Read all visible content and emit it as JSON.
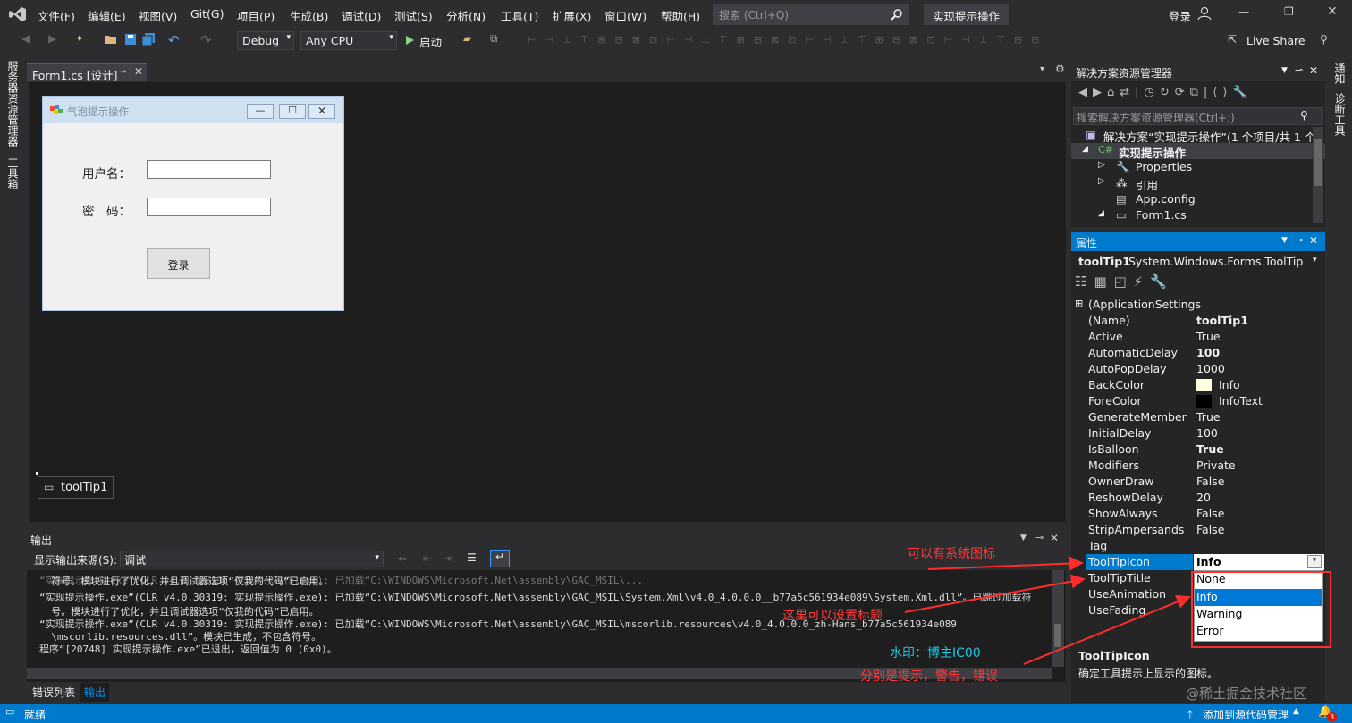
{
  "menu": {
    "items": [
      "文件(F)",
      "编辑(E)",
      "视图(V)",
      "Git(G)",
      "项目(P)",
      "生成(B)",
      "调试(D)",
      "测试(S)",
      "分析(N)",
      "工具(T)",
      "扩展(X)",
      "窗口(W)",
      "帮助(H)"
    ],
    "search_placeholder": "搜索 (Ctrl+Q)",
    "project": "实现提示操作",
    "login": "登录"
  },
  "toolbar": {
    "config": "Debug",
    "platform": "Any CPU",
    "start": "启动",
    "live_share": "Live Share"
  },
  "left_strip": {
    "server_explorer": "服务器资源管理器",
    "toolbox": "工具箱"
  },
  "right_strip": {
    "notifications": "通知",
    "diagnostics": "诊断工具"
  },
  "document": {
    "tab": "Form1.cs [设计]"
  },
  "form": {
    "title": "气泡提示操作",
    "username_label": "用户名：",
    "password_label": "密　码：",
    "login_button": "登录"
  },
  "tray": {
    "component": "toolTip1"
  },
  "output": {
    "title": "输出",
    "source_label": "显示输出来源(S):",
    "source_value": "调试",
    "lines": [
      "  符号。模块进行了优化，并且调试器选项“仅我的代码”已启用。",
      "“实现提示操作.exe”(CLR v4.0.30319: 实现提示操作.exe): 已加载“C:\\WINDOWS\\Microsoft.Net\\assembly\\GAC_MSIL\\System.Xml\\v4.0_4.0.0.0__b77a5c561934e089\\System.Xml.dll”。已跳过加载符",
      "  号。模块进行了优化，并且调试器选项“仅我的代码”已启用。",
      "“实现提示操作.exe”(CLR v4.0.30319: 实现提示操作.exe): 已加载“C:\\WINDOWS\\Microsoft.Net\\assembly\\GAC_MSIL\\mscorlib.resources\\v4.0_4.0.0.0_zh-Hans_b77a5c561934e089",
      "  \\mscorlib.resources.dll”。模块已生成，不包含符号。",
      "程序“[20748] 实现提示操作.exe”已退出，返回值为 0 (0x0)。"
    ]
  },
  "bottom_tabs": [
    "错误列表",
    "输出"
  ],
  "solution_explorer": {
    "title": "解决方案资源管理器",
    "search_placeholder": "搜索解决方案资源管理器(Ctrl+;)",
    "items": [
      {
        "label": "解决方案“实现提示操作”(1 个项目/共 1 个)",
        "bold": false
      },
      {
        "label": "实现提示操作",
        "bold": true
      },
      {
        "label": "Properties",
        "bold": false
      },
      {
        "label": "引用",
        "bold": false
      },
      {
        "label": "App.config",
        "bold": false
      },
      {
        "label": "Form1.cs",
        "bold": false
      }
    ]
  },
  "properties": {
    "title": "属性",
    "object_name": "toolTip1",
    "object_type": "System.Windows.Forms.ToolTip",
    "rows": [
      {
        "name": "(ApplicationSettings",
        "value": "",
        "bold": false
      },
      {
        "name": "(Name)",
        "value": "toolTip1",
        "bold": true
      },
      {
        "name": "Active",
        "value": "True",
        "bold": false
      },
      {
        "name": "AutomaticDelay",
        "value": "100",
        "bold": true
      },
      {
        "name": "AutoPopDelay",
        "value": "1000",
        "bold": false
      },
      {
        "name": "BackColor",
        "value": "Info",
        "bold": false,
        "swatch": "#ffffe1"
      },
      {
        "name": "ForeColor",
        "value": "InfoText",
        "bold": false,
        "swatch": "#000000"
      },
      {
        "name": "GenerateMember",
        "value": "True",
        "bold": false
      },
      {
        "name": "InitialDelay",
        "value": "100",
        "bold": false
      },
      {
        "name": "IsBalloon",
        "value": "True",
        "bold": true
      },
      {
        "name": "Modifiers",
        "value": "Private",
        "bold": false
      },
      {
        "name": "OwnerDraw",
        "value": "False",
        "bold": false
      },
      {
        "name": "ReshowDelay",
        "value": "20",
        "bold": false
      },
      {
        "name": "ShowAlways",
        "value": "False",
        "bold": false
      },
      {
        "name": "StripAmpersands",
        "value": "False",
        "bold": false
      },
      {
        "name": "Tag",
        "value": "",
        "bold": false
      },
      {
        "name": "ToolTipIcon",
        "value": "Info",
        "bold": true
      },
      {
        "name": "ToolTipTitle",
        "value": "",
        "bold": false
      },
      {
        "name": "UseAnimation",
        "value": "",
        "bold": false
      },
      {
        "name": "UseFading",
        "value": "",
        "bold": false
      }
    ],
    "dropdown_options": [
      "None",
      "Info",
      "Warning",
      "Error"
    ],
    "dropdown_selected": "Info",
    "desc_title": "ToolTipIcon",
    "desc_text": "确定工具提示上显示的图标。"
  },
  "annotations": {
    "system_icon": "可以有系统图标",
    "set_title": "这里可以设置标题",
    "watermark": "水印：博主IC00",
    "meaning": "分别是提示，警告，错误",
    "site_watermark": "@稀土掘金技术社区"
  },
  "status": {
    "ready": "就绪",
    "source_control": "添加到源代码管理",
    "notifications_count": "3"
  },
  "colors": {
    "accent": "#007acc",
    "annotation": "#ff3b3b",
    "watermark_cyan": "#1ec8e6"
  }
}
